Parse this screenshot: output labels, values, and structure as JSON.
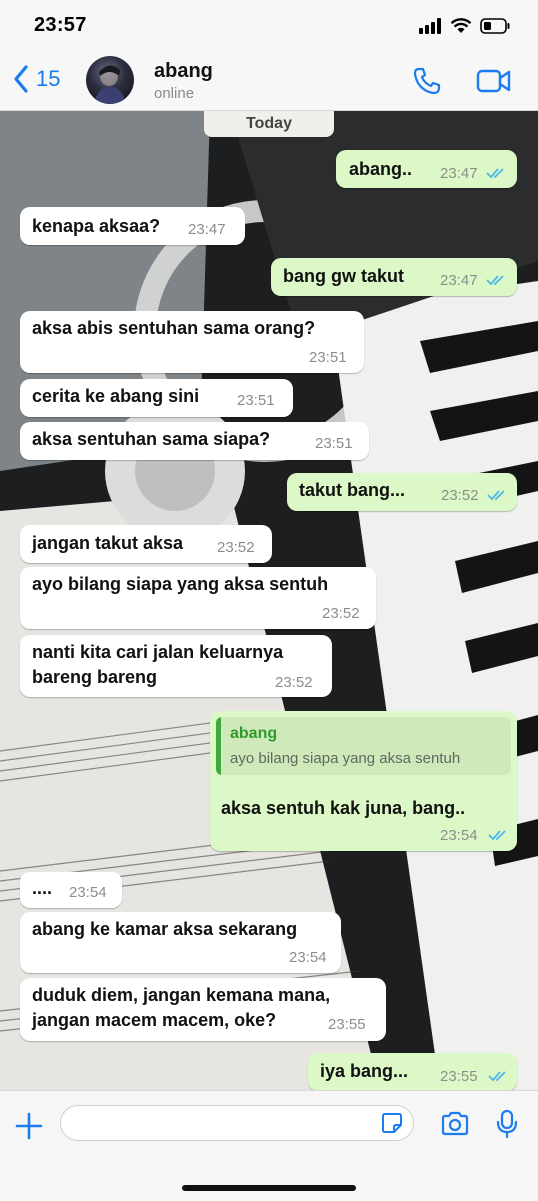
{
  "status_bar": {
    "time": "23:57"
  },
  "header": {
    "back_count": "15",
    "contact_name": "abang",
    "presence": "online"
  },
  "chat": {
    "date_chip": "Today",
    "messages": [
      {
        "dir": "out",
        "text": "abang..",
        "time": "23:47",
        "read": true
      },
      {
        "dir": "in",
        "text": "kenapa aksaa?",
        "time": "23:47"
      },
      {
        "dir": "out",
        "text": "bang gw takut",
        "time": "23:47",
        "read": true
      },
      {
        "dir": "in",
        "text": "aksa abis sentuhan sama orang?",
        "time": "23:51"
      },
      {
        "dir": "in",
        "text": "cerita ke abang sini",
        "time": "23:51"
      },
      {
        "dir": "in",
        "text": "aksa sentuhan sama siapa?",
        "time": "23:51"
      },
      {
        "dir": "out",
        "text": "takut bang...",
        "time": "23:52",
        "read": true
      },
      {
        "dir": "in",
        "text": "jangan takut aksa",
        "time": "23:52"
      },
      {
        "dir": "in",
        "text": "ayo bilang siapa yang aksa sentuh",
        "time": "23:52"
      },
      {
        "dir": "in",
        "text": "nanti kita cari jalan keluarnya\nbareng bareng",
        "time": "23:52"
      },
      {
        "dir": "out",
        "reply_to_name": "abang",
        "reply_to_text": "ayo bilang siapa yang aksa sentuh",
        "text": "aksa sentuh kak juna, bang..",
        "time": "23:54",
        "read": true
      },
      {
        "dir": "in",
        "text": "....",
        "time": "23:54"
      },
      {
        "dir": "in",
        "text": "abang ke kamar aksa sekarang",
        "time": "23:54"
      },
      {
        "dir": "in",
        "text": "duduk diem, jangan kemana mana,\njangan macem macem, oke?",
        "time": "23:55"
      },
      {
        "dir": "out",
        "text": "iya bang...",
        "time": "23:55",
        "read": true
      }
    ]
  },
  "colors": {
    "accent": "#1a7cf0",
    "incoming_bubble": "#ffffff",
    "outgoing_bubble": "#dcf8c6",
    "read_ticks": "#4fb6ec",
    "quote_name": "#2f9c2a"
  },
  "icons": [
    "back-chevron-icon",
    "phone-icon",
    "video-icon",
    "plus-icon",
    "sticker-icon",
    "camera-icon",
    "mic-icon",
    "double-check-icon"
  ]
}
